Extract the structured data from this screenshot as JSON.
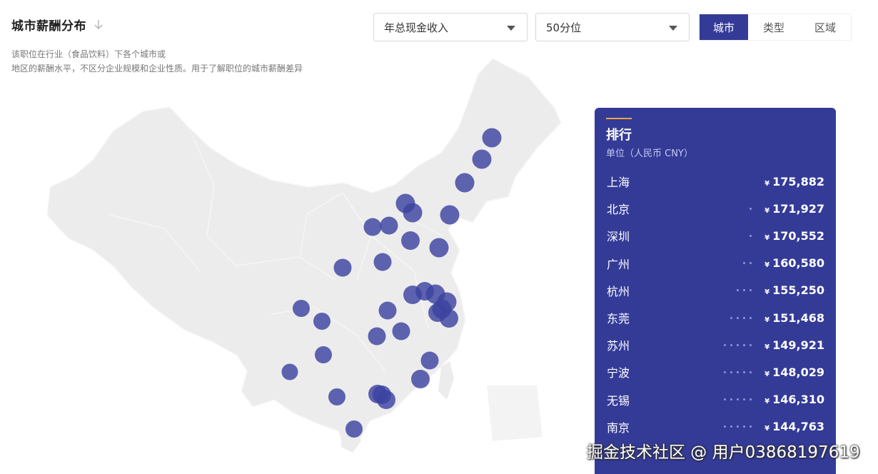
{
  "header": {
    "title": "城市薪酬分布",
    "description_line1": "该职位在行业（食品饮料）下各个城市或",
    "description_line2": "地区的薪酬水平，不区分企业规模和企业性质。用于了解职位的城市薪酬差异"
  },
  "filters": {
    "metric": "年总现金收入",
    "percentile": "50分位"
  },
  "tabs": [
    {
      "label": "城市",
      "active": true
    },
    {
      "label": "类型",
      "active": false
    },
    {
      "label": "区域",
      "active": false
    }
  ],
  "colors": {
    "accent": "#343b97",
    "bubble": "#3c43a0",
    "map_fill": "#ececec",
    "rank_accent_line": "#f2a640"
  },
  "ranking": {
    "title": "排行",
    "unit": "单位（人民币 CNY）",
    "currency_symbol": "¥",
    "items": [
      {
        "city": "上海",
        "value": "175,882",
        "dots": 0
      },
      {
        "city": "北京",
        "value": "171,927",
        "dots": 1
      },
      {
        "city": "深圳",
        "value": "170,552",
        "dots": 1
      },
      {
        "city": "广州",
        "value": "160,580",
        "dots": 2
      },
      {
        "city": "杭州",
        "value": "155,250",
        "dots": 3
      },
      {
        "city": "东莞",
        "value": "151,468",
        "dots": 4
      },
      {
        "city": "苏州",
        "value": "149,921",
        "dots": 5
      },
      {
        "city": "宁波",
        "value": "148,029",
        "dots": 5
      },
      {
        "city": "无锡",
        "value": "146,310",
        "dots": 5
      },
      {
        "city": "南京",
        "value": "144,763",
        "dots": 5
      }
    ]
  },
  "watermark": "掘金技术社区 @ 用户03868197619"
}
